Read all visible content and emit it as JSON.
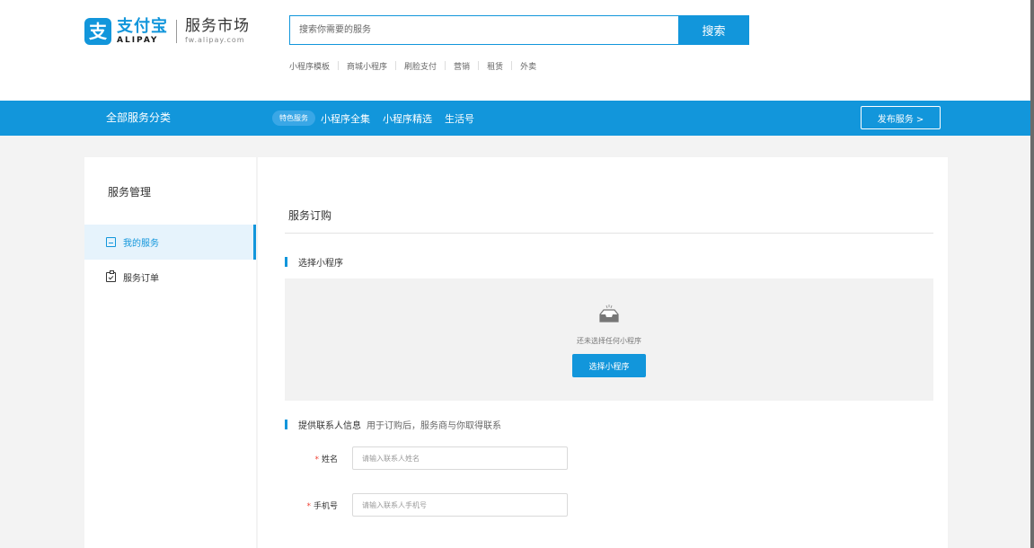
{
  "header": {
    "logo": {
      "mark_glyph": "支",
      "brand_cn": "支付宝",
      "brand_en": "ALIPAY",
      "site_name": "服务市场",
      "site_url": "fw.alipay.com"
    },
    "search": {
      "placeholder": "搜索你需要的服务",
      "button_label": "搜索"
    },
    "hot_links": [
      "小程序模板",
      "商城小程序",
      "刷脸支付",
      "营销",
      "租赁",
      "外卖"
    ]
  },
  "nav": {
    "all_categories": "全部服务分类",
    "pill_label": "特色服务",
    "items": [
      "小程序全集",
      "小程序精选",
      "生活号"
    ],
    "publish_button": "发布服务 >"
  },
  "sidebar": {
    "title": "服务管理",
    "items": [
      {
        "label": "我的服务",
        "icon": "document-icon",
        "active": true
      },
      {
        "label": "服务订单",
        "icon": "clipboard-check-icon",
        "active": false
      }
    ]
  },
  "main": {
    "page_title": "服务订购",
    "section_miniapp": {
      "title": "选择小程序",
      "empty_icon": "empty-inbox-icon",
      "empty_caption": "还未选择任何小程序",
      "select_button": "选择小程序"
    },
    "section_contact": {
      "title": "提供联系人信息",
      "hint": "用于订购后，服务商与你取得联系",
      "fields": [
        {
          "required_mark": "*",
          "label": "姓名",
          "placeholder": "请输入联系人姓名",
          "value": ""
        },
        {
          "required_mark": "*",
          "label": "手机号",
          "placeholder": "请输入联系人手机号",
          "value": ""
        }
      ]
    }
  },
  "colors": {
    "accent": "#1296db",
    "page_bg": "#f3f3f3",
    "panel_bg": "#ffffff",
    "required": "#f04134"
  }
}
